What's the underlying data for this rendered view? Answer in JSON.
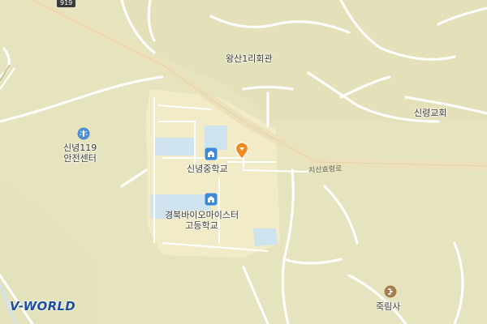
{
  "map": {
    "logo": "V-WORLD",
    "route_badge": "919",
    "road_label": "치산효령로",
    "places": {
      "fire_station": "신녕119\n안전센터",
      "middle_school": "신녕중학교",
      "high_school": "경북바이오마이스터\n고등학교",
      "village_hall": "왕산1리회관",
      "church": "신령교회",
      "temple": "죽림사"
    },
    "icons": {
      "fire_station": "fire-station-icon",
      "school": "school-icon",
      "temple": "temple-icon",
      "location_marker": "location-pin-icon"
    },
    "colors": {
      "background": "#e6e4bf",
      "roads": "#ffffff",
      "main_road": "#ece0ba",
      "campus": "#f1ecc7",
      "school_icon": "#3b87d8",
      "marker": "#f08a1c"
    }
  }
}
